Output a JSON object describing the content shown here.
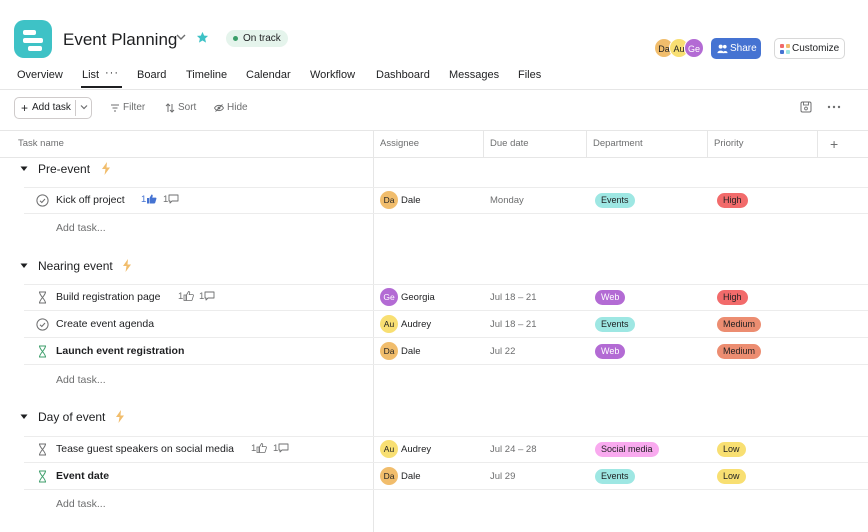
{
  "header": {
    "project_title": "Event Planning",
    "status": "On track",
    "status_color": "#3c9e6a",
    "app_icon_color": "#3ec2c6",
    "members": [
      {
        "initials": "Da",
        "color": "#f1bd6c"
      },
      {
        "initials": "Au",
        "color": "#f8df72"
      },
      {
        "initials": "Ge",
        "color": "#b36bd4"
      }
    ],
    "share_label": "Share",
    "customize_label": "Customize",
    "accent_color": "#4573d2"
  },
  "tabs": [
    {
      "label": "Overview"
    },
    {
      "label": "List",
      "active": true
    },
    {
      "label": "Board"
    },
    {
      "label": "Timeline"
    },
    {
      "label": "Calendar"
    },
    {
      "label": "Workflow"
    },
    {
      "label": "Dashboard"
    },
    {
      "label": "Messages"
    },
    {
      "label": "Files"
    }
  ],
  "toolbar": {
    "add_task_label": "Add task",
    "filter_label": "Filter",
    "sort_label": "Sort",
    "hide_label": "Hide"
  },
  "columns": {
    "task_name": "Task name",
    "assignee": "Assignee",
    "due_date": "Due date",
    "department": "Department",
    "priority": "Priority"
  },
  "add_task_placeholder": "Add task...",
  "sections": [
    {
      "title": "Pre-event",
      "tasks": [
        {
          "name": "Kick off project",
          "bold": false,
          "status_icon": "check-circle-icon",
          "likes": "1",
          "liked": true,
          "comments": "1",
          "assignee": {
            "initials": "Da",
            "name": "Dale",
            "color": "#f1bd6c"
          },
          "due": "Monday",
          "department": {
            "label": "Events",
            "bg": "#9ee7e3"
          },
          "priority": {
            "label": "High",
            "bg": "#f26b6b"
          }
        }
      ]
    },
    {
      "title": "Nearing event",
      "tasks": [
        {
          "name": "Build registration page",
          "bold": false,
          "status_icon": "hourglass-icon",
          "likes": "1",
          "liked": false,
          "comments": "1",
          "assignee": {
            "initials": "Ge",
            "name": "Georgia",
            "color": "#b36bd4"
          },
          "due": "Jul 18 – 21",
          "department": {
            "label": "Web",
            "bg": "#b36bd4"
          },
          "priority": {
            "label": "High",
            "bg": "#f26b6b"
          }
        },
        {
          "name": "Create event agenda",
          "bold": false,
          "status_icon": "check-circle-icon",
          "assignee": {
            "initials": "Au",
            "name": "Audrey",
            "color": "#f8df72"
          },
          "due": "Jul 18 – 21",
          "department": {
            "label": "Events",
            "bg": "#9ee7e3"
          },
          "priority": {
            "label": "Medium",
            "bg": "#ec8d71"
          }
        },
        {
          "name": "Launch event registration",
          "bold": true,
          "status_icon": "hourglass-green-icon",
          "assignee": {
            "initials": "Da",
            "name": "Dale",
            "color": "#f1bd6c"
          },
          "due": "Jul 22",
          "department": {
            "label": "Web",
            "bg": "#b36bd4"
          },
          "priority": {
            "label": "Medium",
            "bg": "#ec8d71"
          }
        }
      ]
    },
    {
      "title": "Day of event",
      "tasks": [
        {
          "name": "Tease guest speakers on social media",
          "bold": false,
          "status_icon": "hourglass-icon",
          "likes": "1",
          "liked": false,
          "comments": "1",
          "assignee": {
            "initials": "Au",
            "name": "Audrey",
            "color": "#f8df72"
          },
          "due": "Jul 24 – 28",
          "department": {
            "label": "Social media",
            "bg": "#f9aaef"
          },
          "priority": {
            "label": "Low",
            "bg": "#f8df72"
          }
        },
        {
          "name": "Event date",
          "bold": true,
          "status_icon": "hourglass-green-icon",
          "assignee": {
            "initials": "Da",
            "name": "Dale",
            "color": "#f1bd6c"
          },
          "due": "Jul 29",
          "department": {
            "label": "Events",
            "bg": "#9ee7e3"
          },
          "priority": {
            "label": "Low",
            "bg": "#f8df72"
          }
        }
      ]
    }
  ]
}
